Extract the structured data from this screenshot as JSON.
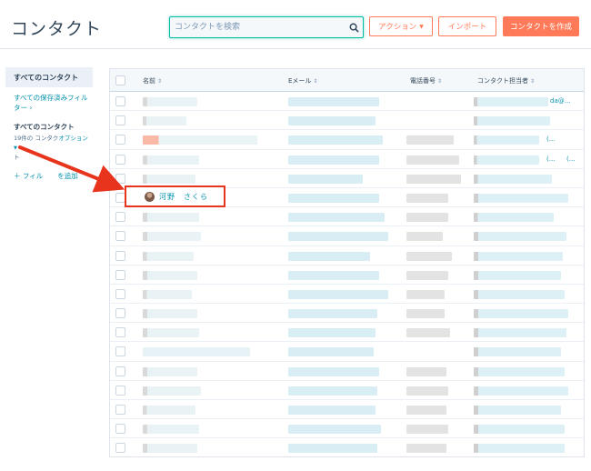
{
  "header": {
    "title": "コンタクト",
    "search_placeholder": "コンタクトを検索",
    "action_label": "アクション",
    "import_label": "インポート",
    "create_label": "コンタクトを作成"
  },
  "sidebar": {
    "all_contacts": "すべてのコンタクト",
    "saved_filters": "すべての保存済みフィルター",
    "saved_filters_chevron": "›",
    "sub_title": "すべてのコンタクト",
    "count_text": "19件の コンタク",
    "options_label": "オプション",
    "count_tail": "ト",
    "add_filter": "＋ フィル",
    "add_filter_tail": "を追加"
  },
  "table": {
    "columns": [
      "名前",
      "Eメール",
      "電話番号",
      "コンタクト担当者"
    ],
    "highlighted_name": "河野　さくら",
    "owner_snippets": [
      "da@...",
      "(...",
      "(...",
      "(..."
    ]
  },
  "colors": {
    "accent": "#ff7a59",
    "teal": "#00bda5",
    "link": "#0091ae",
    "annotation": "#e8341d"
  }
}
